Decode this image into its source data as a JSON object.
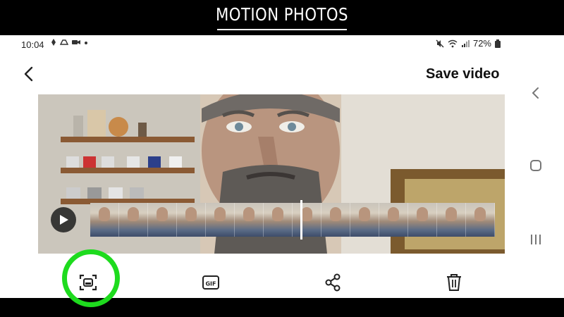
{
  "banner": {
    "title": "MOTION PHOTOS"
  },
  "status_bar": {
    "time": "10:04",
    "battery": "72%"
  },
  "header": {
    "save_label": "Save video"
  },
  "timeline": {
    "frame_count": 14
  },
  "toolbar": {
    "items": [
      {
        "name": "capture-frame",
        "icon": "capture-frame-icon",
        "highlighted": true
      },
      {
        "name": "gif",
        "icon": "gif-icon",
        "label": "GIF"
      },
      {
        "name": "share",
        "icon": "share-icon"
      },
      {
        "name": "delete",
        "icon": "trash-icon"
      }
    ]
  },
  "colors": {
    "highlight": "#1edb1e",
    "banner_bg": "#000000"
  }
}
